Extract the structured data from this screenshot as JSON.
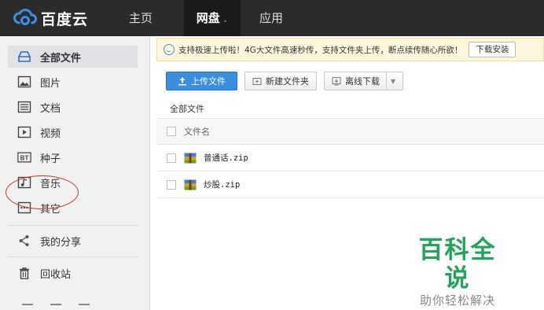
{
  "app": {
    "logo_text": "百度云"
  },
  "topnav": {
    "home": "主页",
    "netdisk": "网盘",
    "apps": "应用"
  },
  "sidebar": {
    "items": [
      {
        "label": "全部文件",
        "icon": "all-files-icon"
      },
      {
        "label": "图片",
        "icon": "image-icon"
      },
      {
        "label": "文档",
        "icon": "document-icon"
      },
      {
        "label": "视频",
        "icon": "video-icon"
      },
      {
        "label": "种子",
        "icon": "bt-icon",
        "icon_text": "BT"
      },
      {
        "label": "音乐",
        "icon": "music-icon"
      },
      {
        "label": "其它",
        "icon": "other-icon"
      },
      {
        "label": "我的分享",
        "icon": "share-icon"
      },
      {
        "label": "回收站",
        "icon": "trash-icon"
      }
    ]
  },
  "notice": {
    "text": "支持极速上传啦！4G大文件高速秒传，支持文件夹上传，断点续传随心所欲！",
    "button": "下载安装"
  },
  "toolbar": {
    "upload": "上传文件",
    "new_folder": "新建文件夹",
    "offline": "离线下载"
  },
  "breadcrumb": "全部文件",
  "table": {
    "header": "文件名",
    "rows": [
      {
        "name": "普通话.zip"
      },
      {
        "name": "炒股.zip"
      }
    ]
  },
  "watermark": {
    "title": "百科全说",
    "subtitle": "助你轻松解决"
  },
  "colors": {
    "topbar": "#2b2b2b",
    "primary": "#3b8de0",
    "annotation": "#c0392b",
    "watermark": "#22a35a"
  }
}
